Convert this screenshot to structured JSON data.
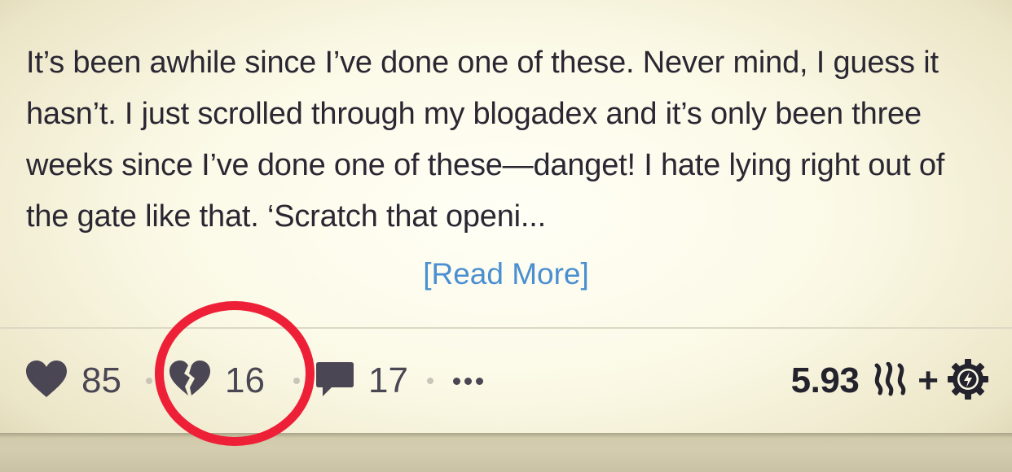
{
  "post": {
    "excerpt": "It’s been awhile since I’ve done one of these. Never mind, I guess it hasn’t. I just scrolled through my blogadex and it’s only been three weeks since I’ve done one of these—danget! I hate lying right out of the gate like that. ‘Scratch that openi...",
    "read_more_label": "[Read More]"
  },
  "footer": {
    "upvotes": "85",
    "downvotes": "16",
    "comments": "17",
    "payout_amount": "5.93",
    "plus": "+"
  },
  "icons": {
    "upvote": "heart-icon",
    "downvote": "broken-heart-icon",
    "comments": "speech-bubble-icon",
    "more": "ellipsis-icon",
    "currency": "steem-logo-icon",
    "boost": "gear-bolt-icon"
  },
  "colors": {
    "text": "#2a2733",
    "link": "#4a8fd0",
    "icon": "#4a4654",
    "highlight": "#ee2038"
  }
}
